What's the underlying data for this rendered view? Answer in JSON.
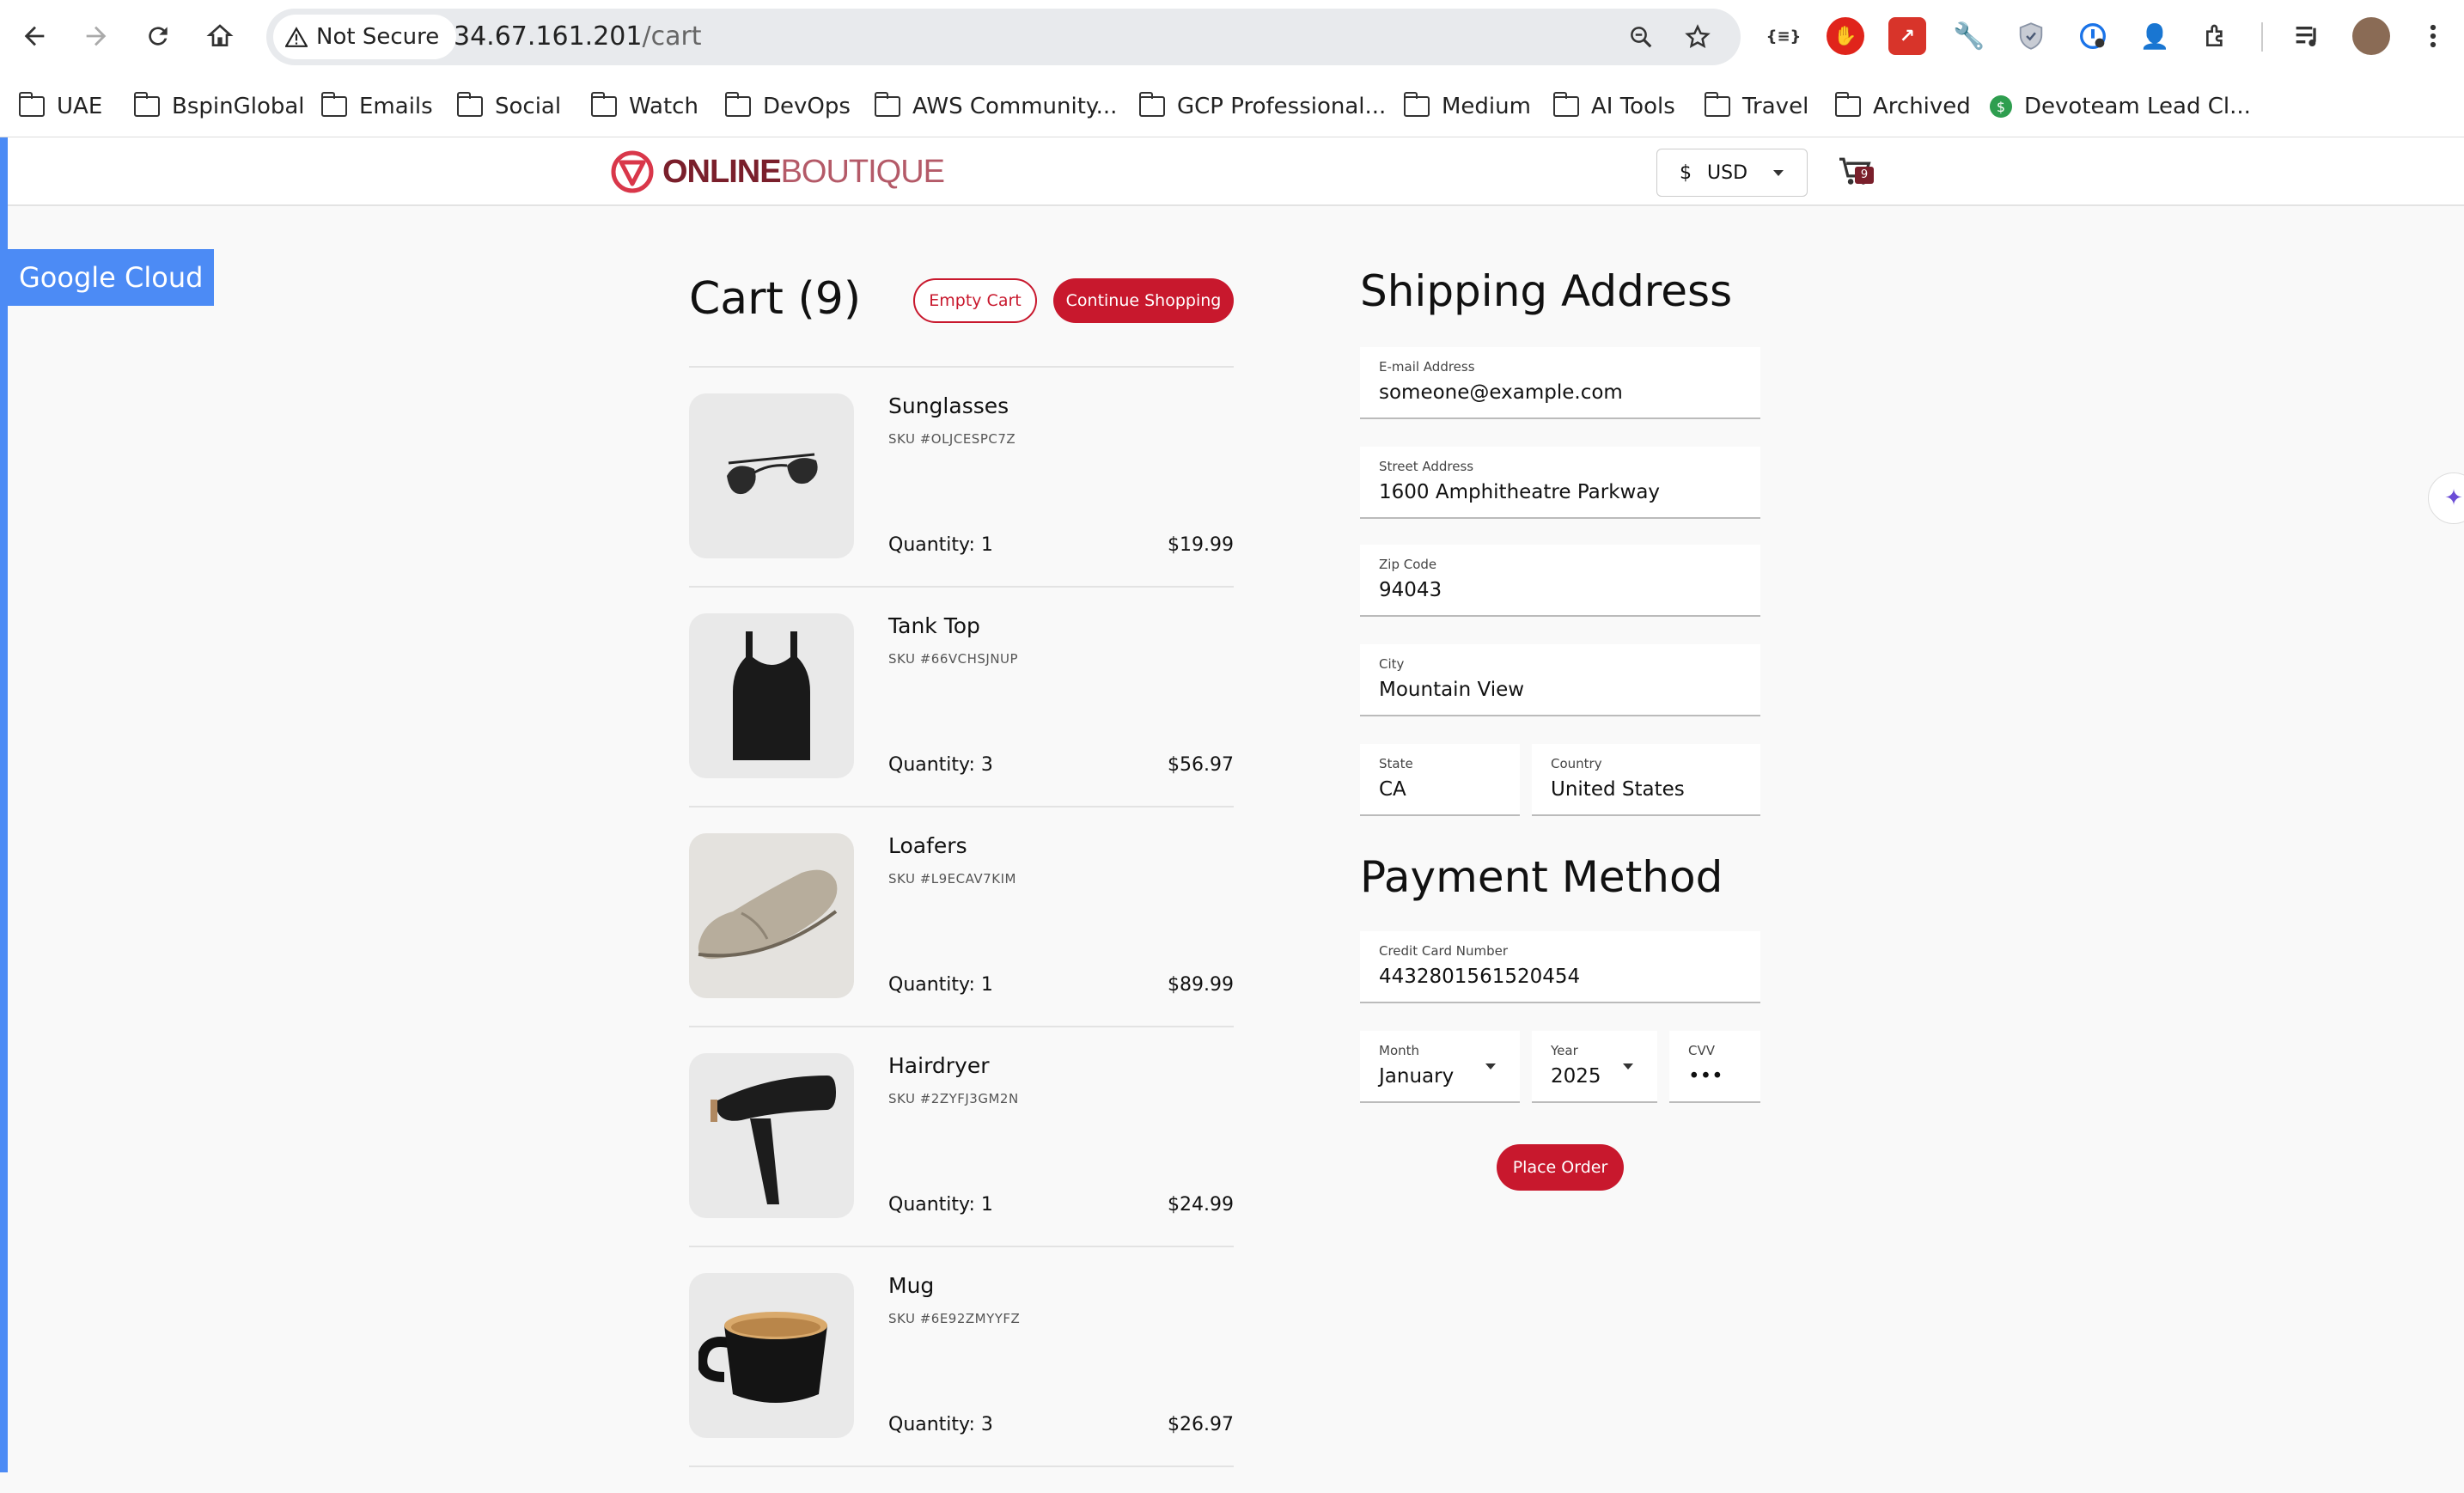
{
  "browser": {
    "security_label": "Not Secure",
    "url_host": "34.67.161.201",
    "url_path": "/cart",
    "bookmarks": [
      "UAE",
      "BspinGlobal",
      "Emails",
      "Social",
      "Watch",
      "DevOps",
      "AWS Community...",
      "GCP Professional...",
      "Medium",
      "AI Tools",
      "Travel",
      "Archived",
      "Devoteam Lead Cl..."
    ]
  },
  "banner": {
    "label": "Google Cloud"
  },
  "header": {
    "logo_bold": "ONLINE",
    "logo_light": "BOUTIQUE",
    "currency_symbol": "$",
    "currency_code": "USD",
    "cart_count": "9"
  },
  "cart": {
    "title": "Cart (9)",
    "empty_label": "Empty Cart",
    "continue_label": "Continue Shopping",
    "items": [
      {
        "name": "Sunglasses",
        "sku": "SKU #OLJCESPC7Z",
        "quantity": "Quantity: 1",
        "price": "$19.99"
      },
      {
        "name": "Tank Top",
        "sku": "SKU #66VCHSJNUP",
        "quantity": "Quantity: 3",
        "price": "$56.97"
      },
      {
        "name": "Loafers",
        "sku": "SKU #L9ECAV7KIM",
        "quantity": "Quantity: 1",
        "price": "$89.99"
      },
      {
        "name": "Hairdryer",
        "sku": "SKU #2ZYFJ3GM2N",
        "quantity": "Quantity: 1",
        "price": "$24.99"
      },
      {
        "name": "Mug",
        "sku": "SKU #6E92ZMYYFZ",
        "quantity": "Quantity: 3",
        "price": "$26.97"
      }
    ]
  },
  "shipping": {
    "title": "Shipping Address",
    "email": {
      "label": "E-mail Address",
      "value": "someone@example.com"
    },
    "street": {
      "label": "Street Address",
      "value": "1600 Amphitheatre Parkway"
    },
    "zip": {
      "label": "Zip Code",
      "value": "94043"
    },
    "city": {
      "label": "City",
      "value": "Mountain View"
    },
    "state": {
      "label": "State",
      "value": "CA"
    },
    "country": {
      "label": "Country",
      "value": "United States"
    }
  },
  "payment": {
    "title": "Payment Method",
    "card": {
      "label": "Credit Card Number",
      "value": "4432801561520454"
    },
    "month": {
      "label": "Month",
      "value": "January"
    },
    "year": {
      "label": "Year",
      "value": "2025"
    },
    "cvv": {
      "label": "CVV",
      "value": "•••"
    },
    "place_label": "Place Order"
  }
}
